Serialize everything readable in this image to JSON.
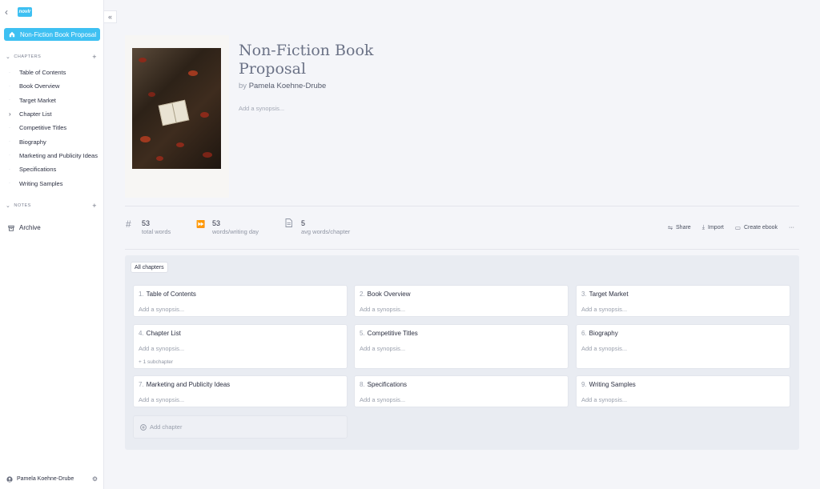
{
  "sidebar": {
    "logo_text": "novlr",
    "active_book": "Non-Fiction Book Proposal",
    "chapters_heading": "CHAPTERS",
    "chapters": [
      {
        "label": "Table of Contents"
      },
      {
        "label": "Book Overview"
      },
      {
        "label": "Target Market"
      },
      {
        "label": "Chapter List",
        "has_children": true
      },
      {
        "label": "Competitive Titles"
      },
      {
        "label": "Biography"
      },
      {
        "label": "Marketing and Publicity Ideas"
      },
      {
        "label": "Specifications"
      },
      {
        "label": "Writing Samples"
      }
    ],
    "notes_heading": "NOTES",
    "archive_label": "Archive",
    "user_name": "Pamela Koehne-Drube"
  },
  "book": {
    "title": "Non-Fiction Book Proposal",
    "by_prefix": "by",
    "author": "Pamela Koehne-Drube",
    "synopsis_placeholder": "Add a synopsis..."
  },
  "stats": [
    {
      "icon": "hash-icon",
      "value": "53",
      "label": "total words"
    },
    {
      "icon": "fast-forward-icon",
      "value": "53",
      "label": "words/writing day"
    },
    {
      "icon": "document-icon",
      "value": "5",
      "label": "avg words/chapter"
    }
  ],
  "actions": {
    "share": "Share",
    "import": "Import",
    "create_ebook": "Create ebook",
    "more": "···"
  },
  "board": {
    "filter_label": "All chapters",
    "cards": [
      {
        "num": "1.",
        "title": "Table of Contents",
        "synopsis": "Add a synopsis..."
      },
      {
        "num": "2.",
        "title": "Book Overview",
        "synopsis": "Add a synopsis..."
      },
      {
        "num": "3.",
        "title": "Target Market",
        "synopsis": "Add a synopsis..."
      },
      {
        "num": "4.",
        "title": "Chapter List",
        "synopsis": "Add a synopsis...",
        "subchapters": "+ 1 subchapter"
      },
      {
        "num": "5.",
        "title": "Competitive Titles",
        "synopsis": "Add a synopsis..."
      },
      {
        "num": "6.",
        "title": "Biography",
        "synopsis": "Add a synopsis..."
      },
      {
        "num": "7.",
        "title": "Marketing and Publicity Ideas",
        "synopsis": "Add a synopsis..."
      },
      {
        "num": "8.",
        "title": "Specifications",
        "synopsis": "Add a synopsis..."
      },
      {
        "num": "9.",
        "title": "Writing Samples",
        "synopsis": "Add a synopsis..."
      }
    ],
    "add_chapter_label": "Add chapter"
  },
  "colors": {
    "accent": "#3ec0f2",
    "board_bg": "#e9ecf2"
  }
}
